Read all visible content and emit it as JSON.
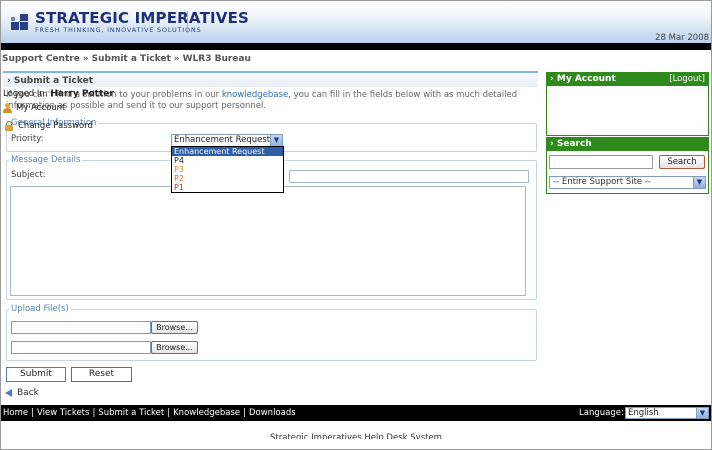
{
  "header": {
    "brand_name": "STRATEGIC IMPERATIVES",
    "brand_tagline": "FRESH THINKING, INNOVATIVE SOLUTIONS",
    "date": "28 Mar 2008"
  },
  "breadcrumb": [
    "Support Centre",
    "Submit a Ticket",
    "WLR3 Bureau"
  ],
  "breadcrumb_separator": "»",
  "panel": {
    "title": "Submit a Ticket",
    "title_marker": "›",
    "intro_before": "If you can't find a solution to your problems in our ",
    "intro_link": "knowledgebase",
    "intro_after": ", you can fill in the fields below with as much detailed information as possible and send it to our support personnel."
  },
  "general": {
    "legend": "General Information",
    "priority_label": "Priority:",
    "priority_selected": "Enhancement Request",
    "priority_options": [
      {
        "label": "Enhancement Request",
        "color": "#ffffff"
      },
      {
        "label": "P4",
        "color": "#222222"
      },
      {
        "label": "P3",
        "color": "#c98a1c"
      },
      {
        "label": "P2",
        "color": "#d2691e"
      },
      {
        "label": "P1",
        "color": "#c0392b"
      }
    ]
  },
  "message": {
    "legend": "Message Details",
    "subject_label": "Subject:"
  },
  "upload": {
    "legend": "Upload File(s)",
    "browse_label": "Browse..."
  },
  "actions": {
    "submit_label": "Submit",
    "reset_label": "Reset",
    "back_label": "Back"
  },
  "sidebar": {
    "account_title": "My Account",
    "logout_label": "[Logout]",
    "logged_in_label": "Logged In:",
    "user_name": "Harry Potter",
    "my_account_link": "My Account",
    "change_password_link": "Change Password",
    "search_title": "Search",
    "search_button": "Search",
    "scope_selected": "-- Entire Support Site --",
    "title_marker": "›"
  },
  "footer": {
    "nav": [
      "Home",
      "View Tickets",
      "Submit a Ticket",
      "Knowledgebase",
      "Downloads"
    ],
    "nav_separator": "|",
    "language_label": "Language:",
    "language_selected": "English",
    "system_name": "Strategic Imperatives Help Desk System"
  },
  "colors": {
    "accent_blue": "#2a6cb0",
    "sidebar_green": "#2f8a1c",
    "dropdown_selected": "#2f5ea8"
  },
  "icons": [
    "chevron-down-icon",
    "user-icon",
    "lock-icon",
    "back-arrow-icon"
  ]
}
